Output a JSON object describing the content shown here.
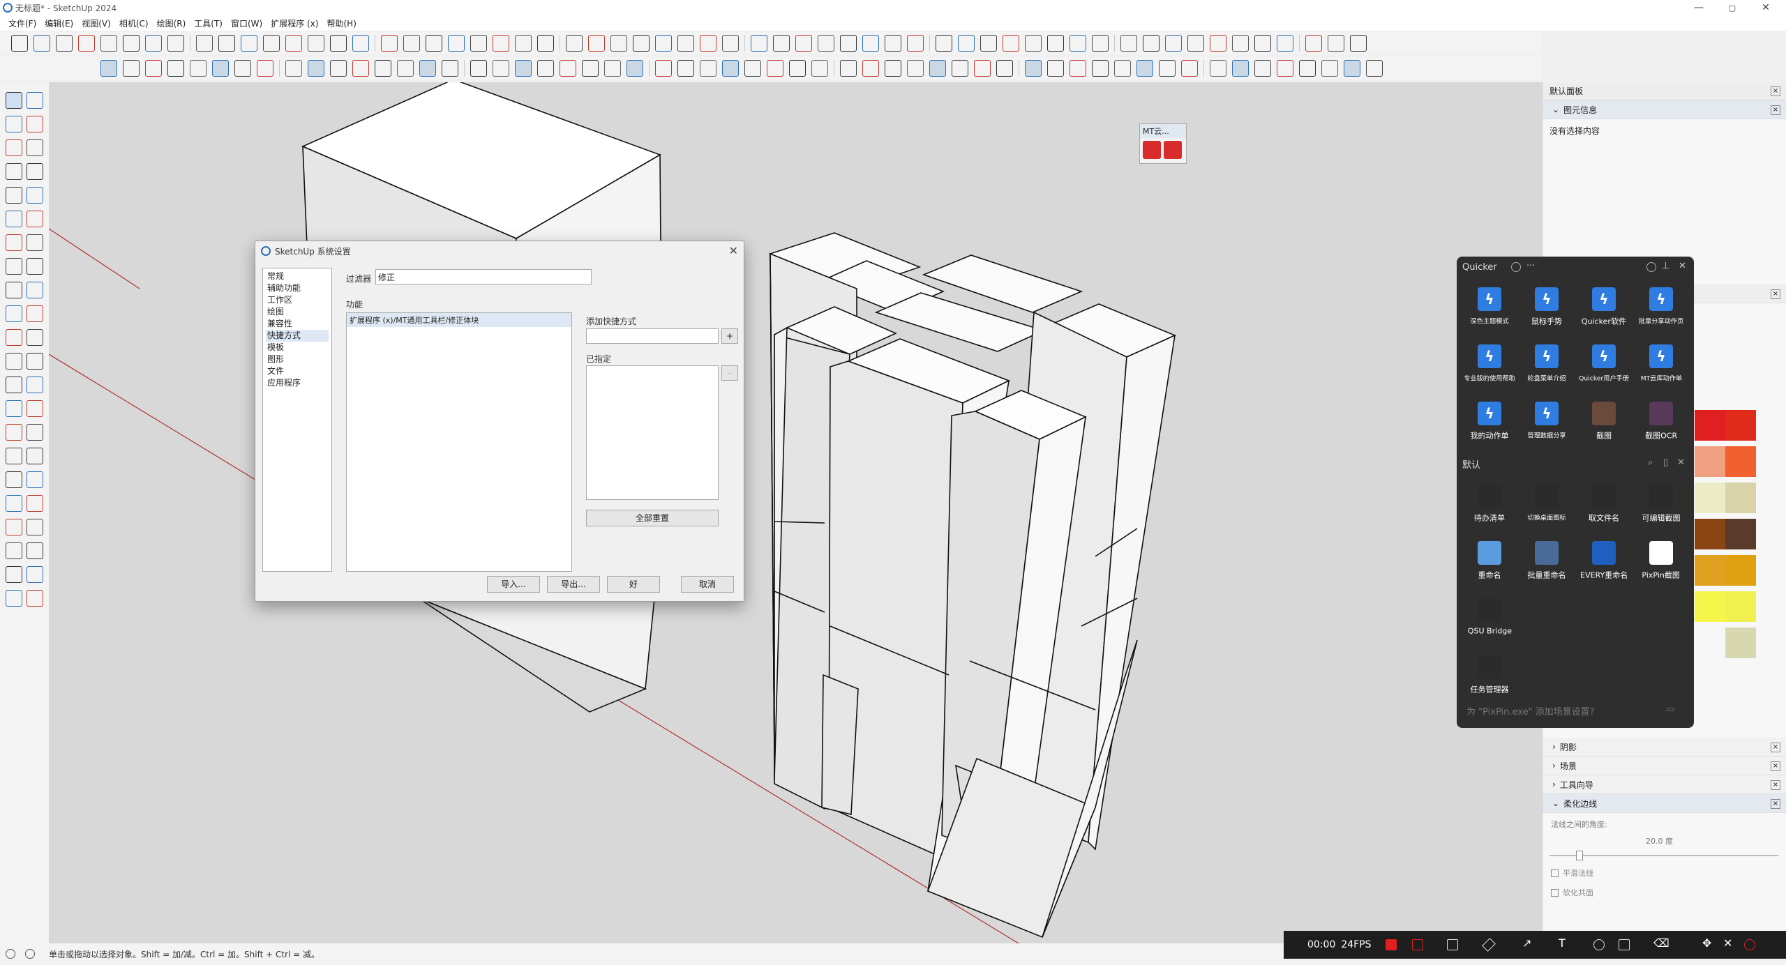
{
  "window": {
    "title": "无标题* - SketchUp 2024",
    "controls": [
      "—",
      "▢",
      "✕"
    ]
  },
  "menu": [
    "文件(F)",
    "编辑(E)",
    "视图(V)",
    "相机(C)",
    "绘图(R)",
    "工具(T)",
    "窗口(W)",
    "扩展程序 (x)",
    "帮助(H)"
  ],
  "status": {
    "hint": "单击或拖动以选择对象。Shift = 加/减。Ctrl = 加。Shift + Ctrl = 减。"
  },
  "dialog": {
    "title": "SketchUp 系统设置",
    "categories": [
      "常规",
      "辅助功能",
      "工作区",
      "绘图",
      "兼容性",
      "快捷方式",
      "模板",
      "图形",
      "文件",
      "应用程序"
    ],
    "selected_category": "快捷方式",
    "filter_label": "过滤器",
    "filter_value": "修正",
    "function_label": "功能",
    "function_items": [
      "扩展程序 (x)/MT通用工具栏/修正体块"
    ],
    "add_shortcut_label": "添加快捷方式",
    "add_btn": "+",
    "assigned_label": "已指定",
    "remove_btn": "-",
    "reset_all": "全部重置",
    "import": "导入...",
    "export": "导出...",
    "ok": "好",
    "cancel": "取消"
  },
  "default_panel": {
    "title": "默认面板",
    "entity_info": "图元信息",
    "entity_text": "没有选择内容",
    "sections": [
      "阴影",
      "场景",
      "工具向导",
      "柔化边线"
    ],
    "soften": {
      "angle_label": "法线之间的角度:",
      "angle_value": "20.0 度",
      "smooth_label": "平滑法线",
      "soften_coplanar": "软化共面"
    }
  },
  "mt_toolbar": {
    "title": "MT云..."
  },
  "quicker": {
    "title": "Quicker",
    "row1": [
      {
        "label": "深色主题模式",
        "small": true
      },
      {
        "label": "鼠标手势",
        "small": false
      },
      {
        "label": "Quicker软件",
        "small": false
      },
      {
        "label": "批量分享动作页",
        "small": true
      }
    ],
    "row2": [
      {
        "label": "专业版的使用帮助",
        "small": true
      },
      {
        "label": "轮盘菜单介绍",
        "small": true
      },
      {
        "label": "Quicker用户手册",
        "small": true
      },
      {
        "label": "MT云库动作单",
        "small": true
      }
    ],
    "row3": [
      {
        "label": "我的动作单",
        "small": false
      },
      {
        "label": "管理数据分享",
        "small": true
      },
      {
        "label": "截图",
        "small": false
      },
      {
        "label": "截图OCR",
        "small": false
      }
    ],
    "section": "默认",
    "row4": [
      {
        "label": "待办清单",
        "small": false
      },
      {
        "label": "切换桌面图标",
        "small": true
      },
      {
        "label": "取文件名",
        "small": false
      },
      {
        "label": "可编辑截图",
        "small": false
      }
    ],
    "row5": [
      {
        "label": "重命名",
        "small": false
      },
      {
        "label": "批量重命名",
        "small": false
      },
      {
        "label": "EVERY重命名",
        "small": false
      },
      {
        "label": "PixPin截图",
        "small": false
      }
    ],
    "row6": [
      {
        "label": "QSU Bridge",
        "small": false
      }
    ],
    "row7": [
      {
        "label": "任务管理器",
        "small": false
      }
    ],
    "footer": "为 \"PixPin.exe\" 添加场景设置?"
  },
  "recorder": {
    "time": "00:00",
    "fps": "24FPS"
  },
  "colors": {
    "accent": "#2a6fb5",
    "quicker_bg": "#2e2e2e",
    "swatch": [
      "#e02020",
      "#e02a1a",
      "#f0a080",
      "#f06030",
      "#ecebc8",
      "#d8d4a8",
      "#8b4513",
      "#5a3a2a",
      "#e0a020",
      "#e0a010",
      "#f6f64a",
      "#f0f050",
      "#d8d8b0"
    ]
  }
}
